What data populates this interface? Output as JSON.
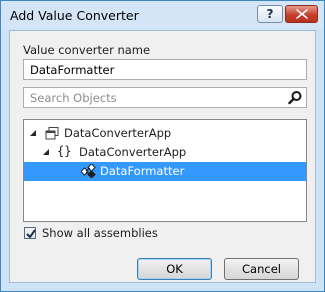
{
  "window": {
    "title": "Add Value Converter",
    "help_label": "?"
  },
  "form": {
    "name_label": "Value converter name",
    "name_value": "DataFormatter",
    "search_placeholder": "Search Objects"
  },
  "tree": {
    "items": [
      {
        "label": "DataConverterApp",
        "kind": "assembly",
        "expanded": true,
        "selected": false
      },
      {
        "label": "DataConverterApp",
        "kind": "namespace",
        "expanded": true,
        "selected": false
      },
      {
        "label": "DataFormatter",
        "kind": "class",
        "selected": true
      }
    ]
  },
  "options": {
    "show_all_assemblies_label": "Show all assemblies",
    "show_all_assemblies_checked": true
  },
  "buttons": {
    "ok_label": "OK",
    "cancel_label": "Cancel"
  },
  "colors": {
    "selection": "#3399ff",
    "title_bar": "#d4e5f7",
    "close_button": "#c6402c"
  }
}
